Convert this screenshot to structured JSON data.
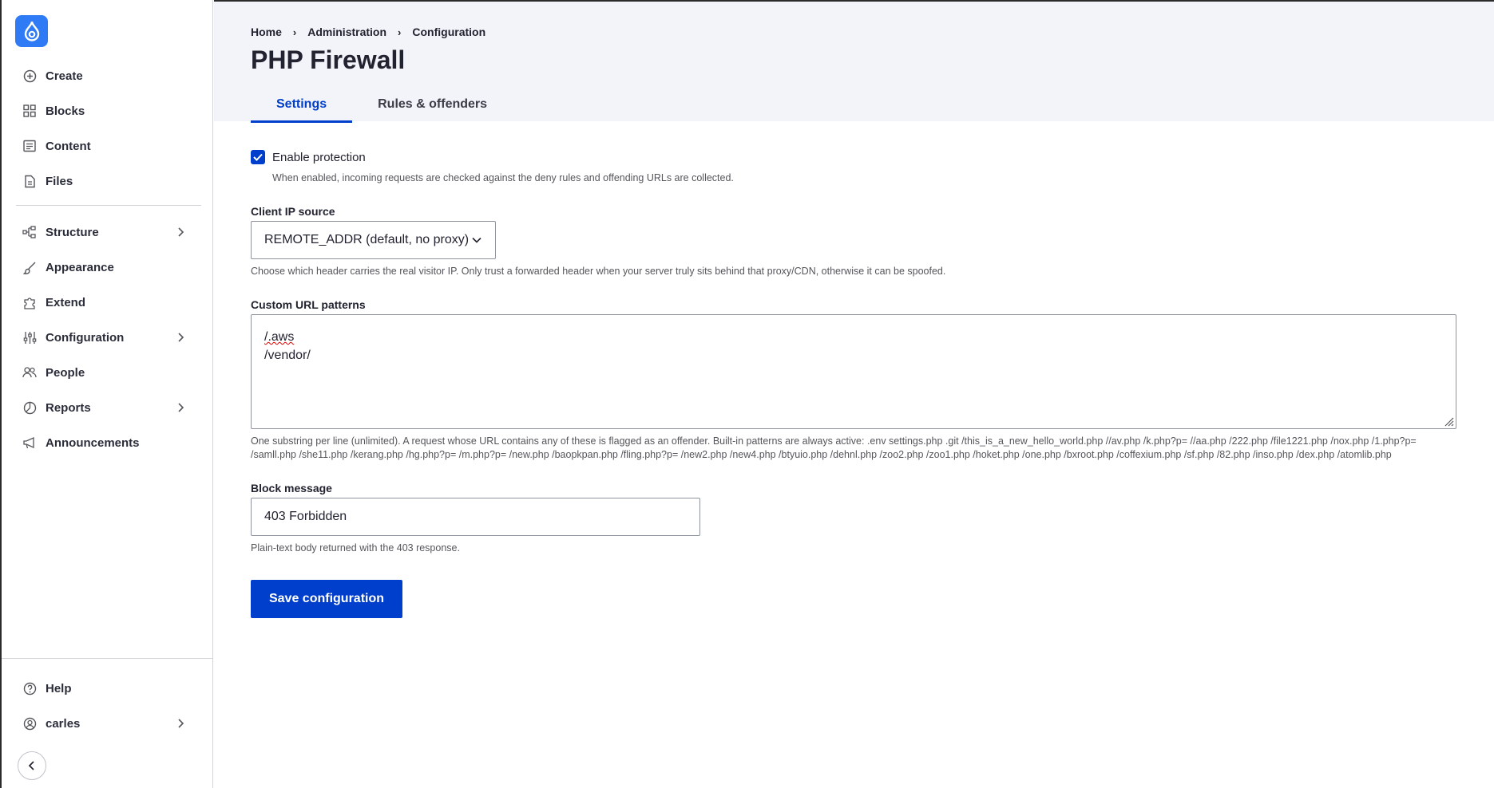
{
  "sidebar": {
    "items": [
      {
        "label": "Create",
        "icon": "plus-circle-icon"
      },
      {
        "label": "Blocks",
        "icon": "grid-icon"
      },
      {
        "label": "Content",
        "icon": "document-list-icon"
      },
      {
        "label": "Files",
        "icon": "file-icon"
      },
      {
        "label": "Structure",
        "icon": "structure-icon"
      },
      {
        "label": "Appearance",
        "icon": "brush-icon"
      },
      {
        "label": "Extend",
        "icon": "puzzle-icon"
      },
      {
        "label": "Configuration",
        "icon": "sliders-icon"
      },
      {
        "label": "People",
        "icon": "people-icon"
      },
      {
        "label": "Reports",
        "icon": "chart-pie-icon"
      },
      {
        "label": "Announcements",
        "icon": "megaphone-icon"
      }
    ],
    "footer": [
      {
        "label": "Help",
        "icon": "help-icon"
      },
      {
        "label": "carles",
        "icon": "user-icon"
      }
    ]
  },
  "breadcrumb": [
    "Home",
    "Administration",
    "Configuration"
  ],
  "page_title": "PHP Firewall",
  "tabs": [
    {
      "label": "Settings",
      "active": true
    },
    {
      "label": "Rules & offenders",
      "active": false
    }
  ],
  "form": {
    "enable": {
      "label": "Enable protection",
      "checked": true,
      "description": "When enabled, incoming requests are checked against the deny rules and offending URLs are collected."
    },
    "ip_source": {
      "label": "Client IP source",
      "value": "REMOTE_ADDR (default, no proxy)",
      "description": "Choose which header carries the real visitor IP. Only trust a forwarded header when your server truly sits behind that proxy/CDN, otherwise it can be spoofed."
    },
    "patterns": {
      "label": "Custom URL patterns",
      "lines": [
        "/.aws",
        "/vendor/"
      ],
      "description": "One substring per line (unlimited). A request whose URL contains any of these is flagged as an offender. Built-in patterns are always active: .env settings.php .git /this_is_a_new_hello_world.php //av.php /k.php?p= //aa.php /222.php /file1221.php /nox.php /1.php?p= /samll.php /she11.php /kerang.php /hg.php?p= /m.php?p= /new.php /baopkpan.php /fling.php?p= /new2.php /new4.php /btyuio.php /dehnl.php /zoo2.php /zoo1.php /hoket.php /one.php /bxroot.php /coffexium.php /sf.php /82.php /inso.php /dex.php /atomlib.php"
    },
    "block_message": {
      "label": "Block message",
      "value": "403 Forbidden",
      "description": "Plain-text body returned with the 403 response."
    },
    "save_label": "Save configuration"
  },
  "colors": {
    "accent": "#003ecc",
    "logo": "#2f7bf5",
    "header_bg": "#f3f4f9"
  }
}
